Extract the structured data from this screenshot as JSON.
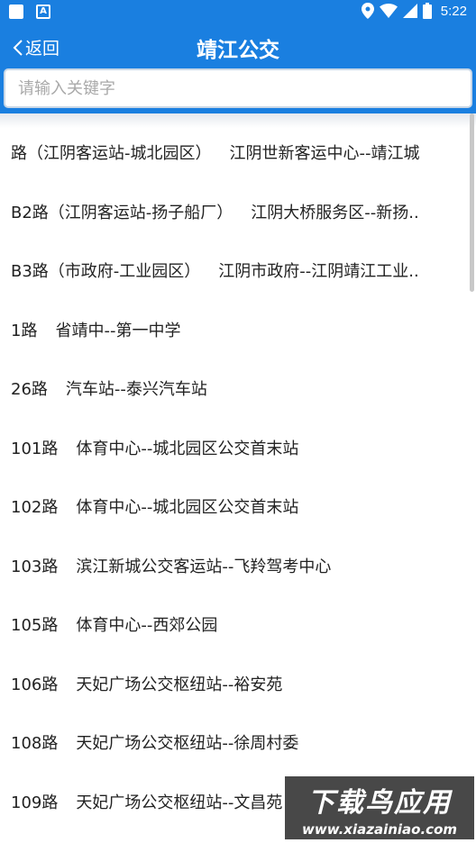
{
  "status_bar": {
    "time": "5:22"
  },
  "header": {
    "back_label": "返回",
    "title": "靖江公交"
  },
  "search": {
    "placeholder": "请输入关键字",
    "value": ""
  },
  "routes": [
    {
      "route": "路（江阴客运站-城北园区）",
      "stops": "江阴世新客运中心--靖江城"
    },
    {
      "route": "B2路（江阴客运站-扬子船厂）",
      "stops": "江阴大桥服务区--新扬.."
    },
    {
      "route": "B3路（市政府-工业园区）",
      "stops": "江阴市政府--江阴靖江工业.."
    },
    {
      "route": "1路",
      "stops": "省靖中--第一中学"
    },
    {
      "route": "26路",
      "stops": "汽车站--泰兴汽车站"
    },
    {
      "route": "101路",
      "stops": "体育中心--城北园区公交首末站"
    },
    {
      "route": "102路",
      "stops": "体育中心--城北园区公交首末站"
    },
    {
      "route": "103路",
      "stops": "滨江新城公交客运站--飞羚驾考中心"
    },
    {
      "route": "105路",
      "stops": "体育中心--西郊公园"
    },
    {
      "route": "106路",
      "stops": "天妃广场公交枢纽站--裕安苑"
    },
    {
      "route": "108路",
      "stops": "天妃广场公交枢纽站--徐周村委"
    },
    {
      "route": "109路",
      "stops": "天妃广场公交枢纽站--文昌苑"
    }
  ],
  "watermark": {
    "main": "下载鸟应用",
    "url": "www.xiazainiao.com"
  },
  "colors": {
    "primary": "#1a7fe0"
  }
}
